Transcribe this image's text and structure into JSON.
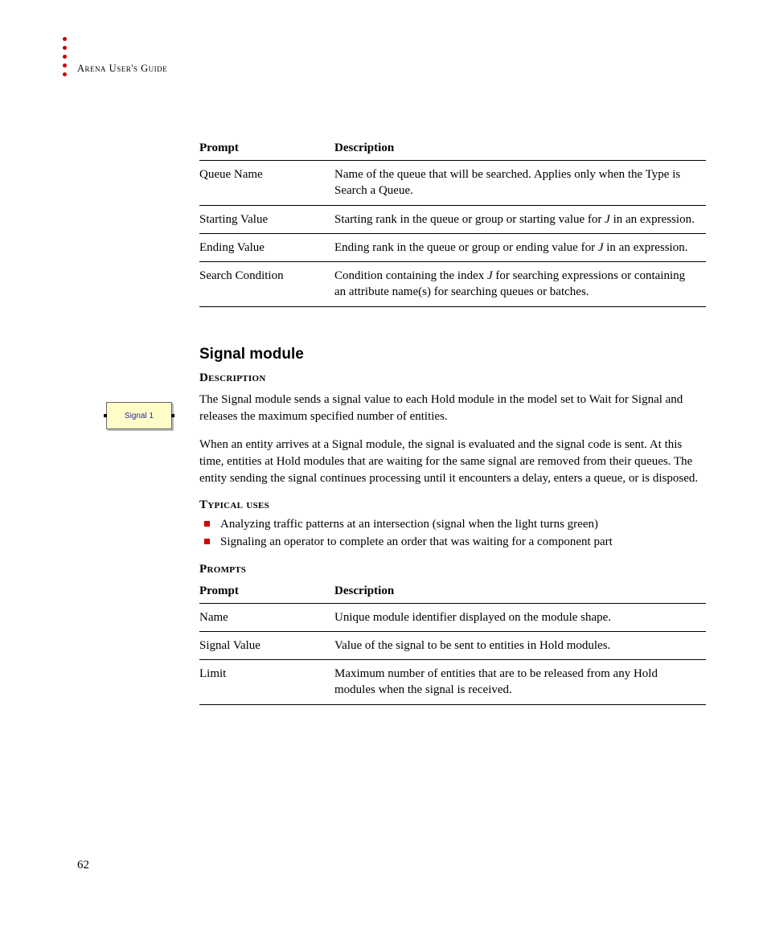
{
  "header": {
    "running_head_prefix": "A",
    "running_head_mid": "rena",
    "running_head_sep": " U",
    "running_head_mid2": "ser's",
    "running_head_sep2": " G",
    "running_head_end": "uide"
  },
  "table1": {
    "head_prompt": "Prompt",
    "head_desc": "Description",
    "rows": [
      {
        "prompt": "Queue Name",
        "desc": "Name of the queue that will be searched. Applies only when the Type is Search a Queue."
      },
      {
        "prompt": "Starting Value",
        "desc_pre": "Starting rank in the queue or group or starting value for ",
        "desc_j": "J",
        "desc_post": " in an expression."
      },
      {
        "prompt": "Ending Value",
        "desc_pre": "Ending rank in the queue or group or ending value for ",
        "desc_j": "J",
        "desc_post": " in an expression."
      },
      {
        "prompt": "Search Condition",
        "desc_pre": "Condition containing the index ",
        "desc_j": "J",
        "desc_post": " for searching expressions or containing an attribute name(s) for searching queues or batches."
      }
    ]
  },
  "section": {
    "title": "Signal module",
    "desc_heading": "Description",
    "para1": "The Signal module sends a signal value to each Hold module in the model set to Wait for Signal and releases the maximum specified number of entities.",
    "para2": "When an entity arrives at a Signal module, the signal is evaluated and the signal code is sent. At this time, entities at Hold modules that are waiting for the same signal are removed from their queues. The entity sending the signal continues processing until it encounters a delay, enters a queue, or is disposed.",
    "uses_heading": "Typical uses",
    "uses": [
      "Analyzing traffic patterns at an intersection (signal when the light turns green)",
      "Signaling an operator to complete an order that was waiting for a component part"
    ],
    "prompts_heading": "Prompts"
  },
  "table2": {
    "head_prompt": "Prompt",
    "head_desc": "Description",
    "rows": [
      {
        "prompt": "Name",
        "desc": "Unique module identifier displayed on the module shape."
      },
      {
        "prompt": "Signal Value",
        "desc": "Value of the signal to be sent to entities in Hold modules."
      },
      {
        "prompt": "Limit",
        "desc": "Maximum number of entities that are to be released from any Hold modules when the signal is received."
      }
    ]
  },
  "module_icon_label": "Signal 1",
  "page_number": "62"
}
